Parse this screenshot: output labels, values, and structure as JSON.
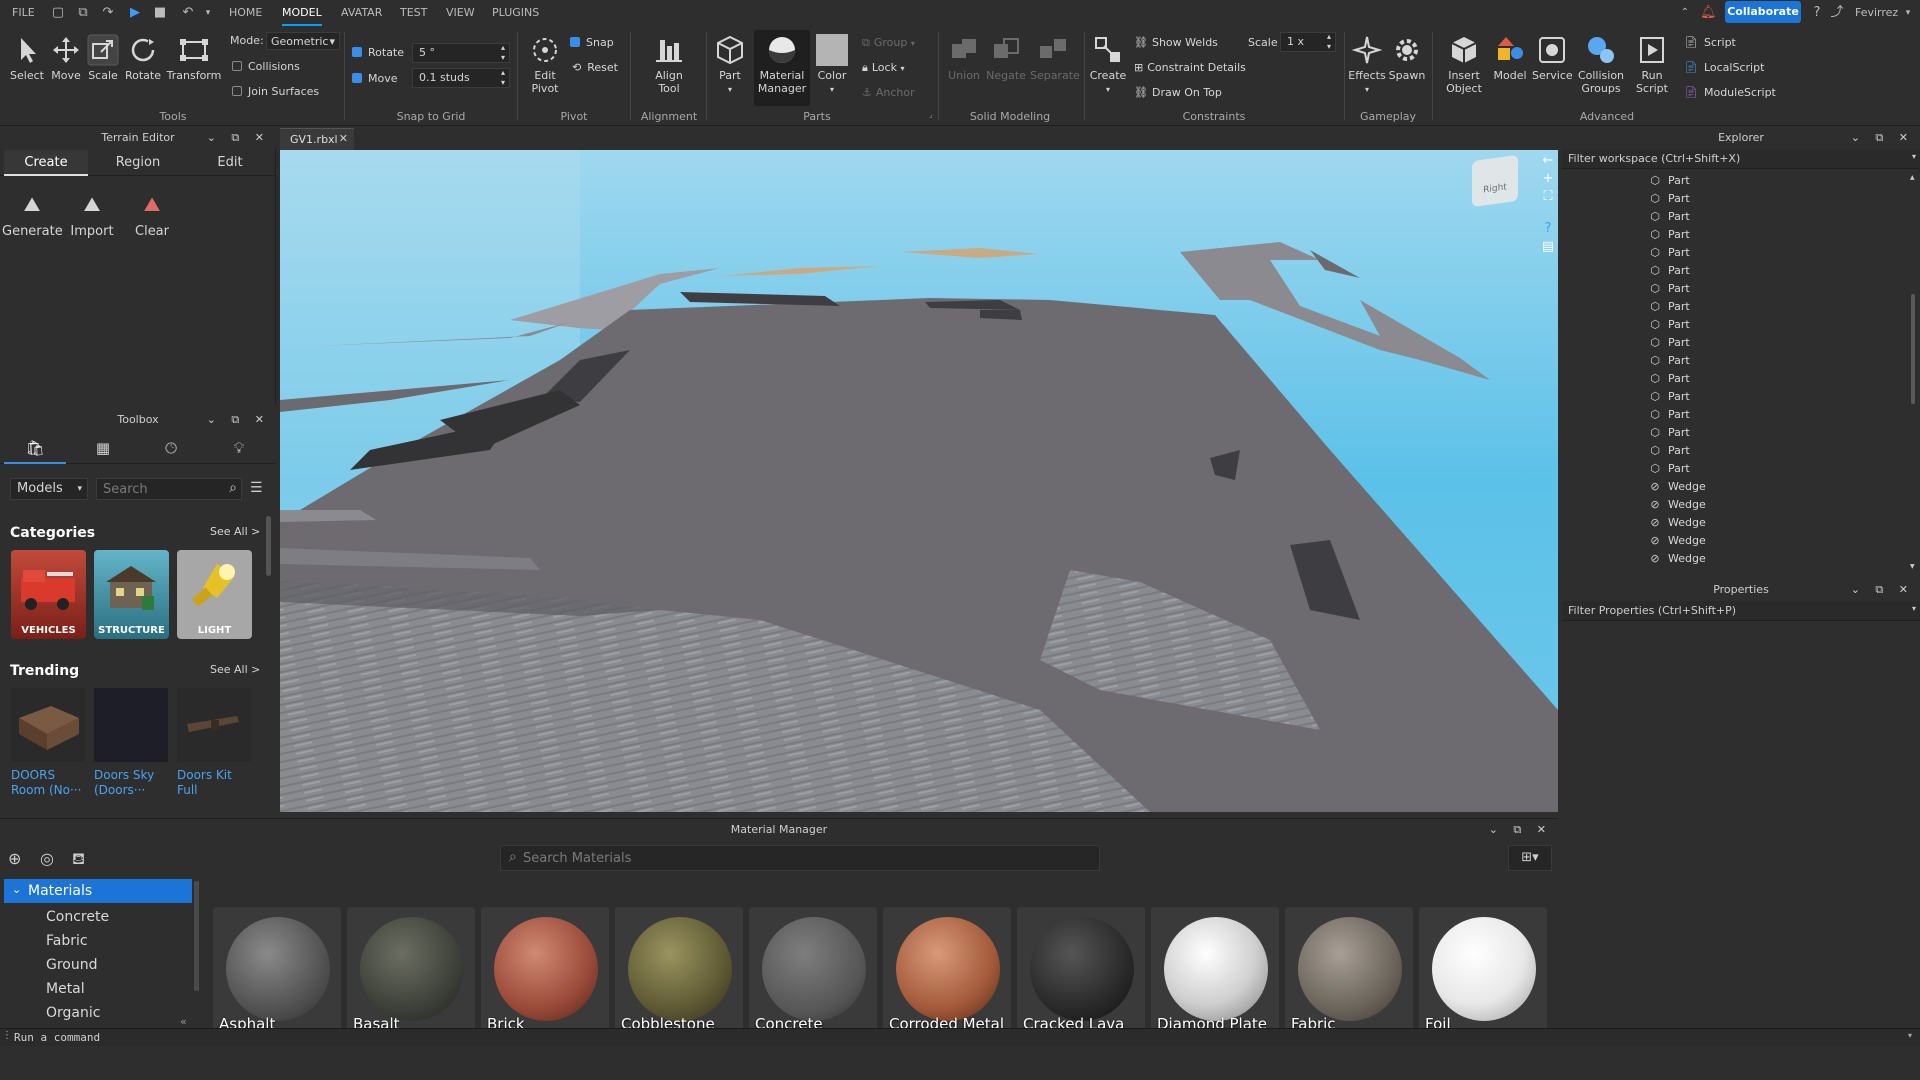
{
  "menubar": {
    "file": "FILE",
    "tabs": [
      "HOME",
      "MODEL",
      "AVATAR",
      "TEST",
      "VIEW",
      "PLUGINS"
    ],
    "active_tab": "MODEL",
    "collaborate": "Collaborate",
    "username": "Fevirrez"
  },
  "ribbon": {
    "tools": {
      "select": "Select",
      "move": "Move",
      "scale": "Scale",
      "rotate": "Rotate",
      "transform": "Transform",
      "group_label": "Tools"
    },
    "mode_label": "Mode:",
    "mode_value": "Geometric",
    "collisions": "Collisions",
    "join_surfaces": "Join Surfaces",
    "snap": {
      "rotate_label": "Rotate",
      "rotate_value": "5 °",
      "move_label": "Move",
      "move_value": "0.1 studs",
      "group_label": "Snap to Grid"
    },
    "pivot": {
      "edit_pivot": "Edit\nPivot",
      "snap": "Snap",
      "reset": "Reset",
      "group_label": "Pivot"
    },
    "alignment": {
      "align_tool": "Align\nTool",
      "group_label": "Alignment"
    },
    "parts": {
      "part": "Part",
      "material_manager": "Material\nManager",
      "color": "Color",
      "group": "Group",
      "lock": "Lock",
      "anchor": "Anchor",
      "group_label": "Parts"
    },
    "solid": {
      "union": "Union",
      "negate": "Negate",
      "separate": "Separate",
      "group_label": "Solid Modeling"
    },
    "constraints": {
      "create": "Create",
      "show_welds": "Show Welds",
      "constraint_details": "Constraint Details",
      "draw_on_top": "Draw On Top",
      "scale_label": "Scale",
      "scale_value": "1 x",
      "group_label": "Constraints"
    },
    "gameplay": {
      "effects": "Effects",
      "spawn": "Spawn",
      "group_label": "Gameplay"
    },
    "advanced": {
      "insert_object": "Insert\nObject",
      "model": "Model",
      "service": "Service",
      "collision_groups": "Collision\nGroups",
      "run_script": "Run\nScript",
      "script": "Script",
      "local_script": "LocalScript",
      "module_script": "ModuleScript",
      "group_label": "Advanced"
    }
  },
  "terrain": {
    "title": "Terrain Editor",
    "tabs": [
      "Create",
      "Region",
      "Edit"
    ],
    "active_tab": "Create",
    "actions": [
      "Generate",
      "Import",
      "Clear"
    ]
  },
  "toolbox": {
    "title": "Toolbox",
    "dropdown": "Models",
    "search_placeholder": "Search",
    "categories_title": "Categories",
    "see_all": "See All >",
    "categories": [
      "VEHICLES",
      "STRUCTURE",
      "LIGHT"
    ],
    "trending_title": "Trending",
    "trending": [
      {
        "line1": "DOORS",
        "line2": "Room (No···"
      },
      {
        "line1": "Doors Sky",
        "line2": "(Doors···"
      },
      {
        "line1": "Doors Kit",
        "line2": "Full"
      }
    ]
  },
  "viewport": {
    "tab": "GV1.rbxl",
    "viewcube_face": "Right"
  },
  "explorer": {
    "title": "Explorer",
    "filter_placeholder": "Filter workspace (Ctrl+Shift+X)",
    "items": [
      "Part",
      "Part",
      "Part",
      "Part",
      "Part",
      "Part",
      "Part",
      "Part",
      "Part",
      "Part",
      "Part",
      "Part",
      "Part",
      "Part",
      "Part",
      "Part",
      "Part",
      "Wedge",
      "Wedge",
      "Wedge",
      "Wedge",
      "Wedge"
    ]
  },
  "properties": {
    "title": "Properties",
    "filter_placeholder": "Filter Properties (Ctrl+Shift+P)"
  },
  "material_manager": {
    "title": "Material Manager",
    "search_placeholder": "Search Materials",
    "tree_root": "Materials",
    "tree_items": [
      "Concrete",
      "Fabric",
      "Ground",
      "Metal",
      "Organic"
    ],
    "materials": [
      "Asphalt",
      "Basalt",
      "Brick",
      "Cobblestone",
      "Concrete",
      "Corroded Metal",
      "Cracked Lava",
      "Diamond Plate",
      "Fabric",
      "Foil"
    ]
  },
  "command_bar": {
    "placeholder": "Run a command"
  }
}
